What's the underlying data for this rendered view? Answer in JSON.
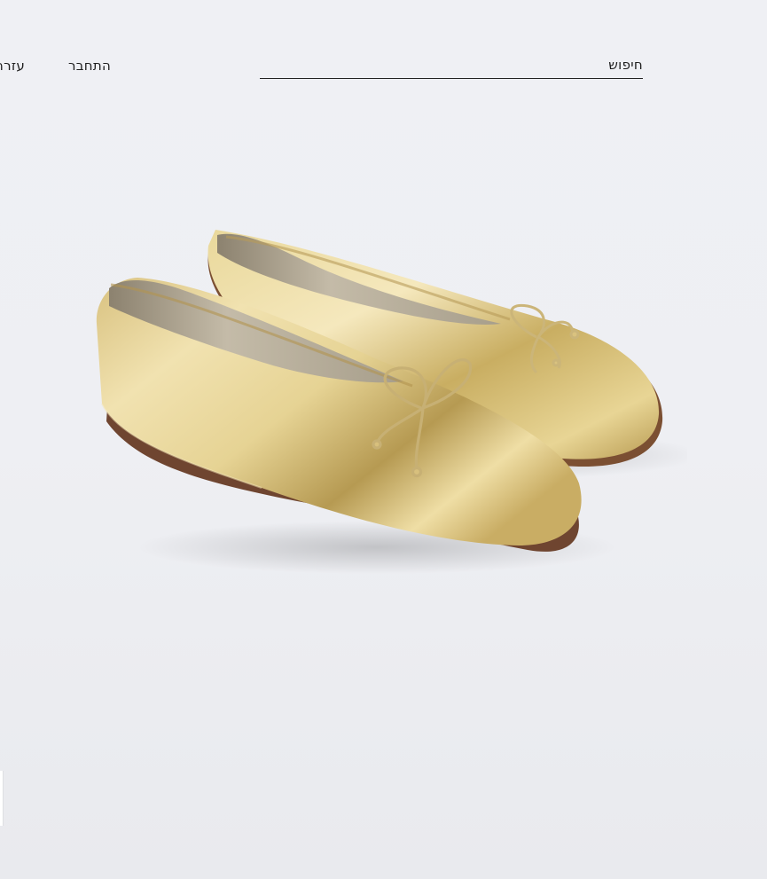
{
  "header": {
    "search_label": "חיפוש",
    "login_label": "התחבר",
    "help_label": "עזרה"
  },
  "product": {
    "image_alt": "gold metallic ballet flats with bow",
    "colors": {
      "gold_light": "#f3e6b8",
      "gold_mid": "#d9c47f",
      "gold_dark": "#a88f4c",
      "lining": "#c7bfae",
      "sole": "#8a5a3b",
      "background": "#eff0f4"
    }
  }
}
